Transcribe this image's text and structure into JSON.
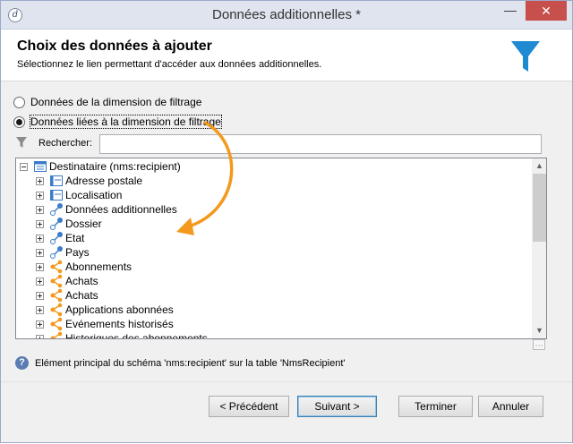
{
  "window": {
    "title": "Données additionnelles *",
    "minimize_glyph": "—",
    "close_glyph": "✕",
    "app_icon_glyph": "d"
  },
  "header": {
    "title": "Choix des données à ajouter",
    "subtitle": "Sélectionnez le lien permettant d'accéder aux données additionnelles.",
    "icon": "funnel-icon",
    "icon_color": "#1f8ad1"
  },
  "options": [
    {
      "label": "Données de la dimension de filtrage",
      "checked": false
    },
    {
      "label": "Données liées à la dimension de filtrage",
      "checked": true
    }
  ],
  "search": {
    "label": "Rechercher:",
    "value": ""
  },
  "tree": {
    "root": {
      "label": "Destinataire (nms:recipient)",
      "icon": "table-icon"
    },
    "children": [
      {
        "label": "Adresse postale",
        "icon": "table-icon"
      },
      {
        "label": "Localisation",
        "icon": "table-icon"
      },
      {
        "label": "Données additionnelles",
        "icon": "link-icon"
      },
      {
        "label": "Dossier",
        "icon": "link-icon"
      },
      {
        "label": "Etat",
        "icon": "link-icon"
      },
      {
        "label": "Pays",
        "icon": "link-icon"
      },
      {
        "label": "Abonnements",
        "icon": "collection-icon"
      },
      {
        "label": "Achats",
        "icon": "collection-icon"
      },
      {
        "label": "Achats",
        "icon": "collection-icon"
      },
      {
        "label": "Applications abonnées",
        "icon": "collection-icon"
      },
      {
        "label": "Evénements historisés",
        "icon": "collection-icon"
      },
      {
        "label": "Historiques des abonnements",
        "icon": "collection-icon"
      }
    ]
  },
  "info": {
    "text": "Elément principal du schéma 'nms:recipient' sur la table 'NmsRecipient'"
  },
  "buttons": {
    "previous": "< Précédent",
    "next": "Suivant >",
    "finish": "Terminer",
    "cancel": "Annuler"
  },
  "colors": {
    "accent_blue": "#1f8ad1",
    "orange": "#f39a1e",
    "close_red": "#c7504c"
  }
}
